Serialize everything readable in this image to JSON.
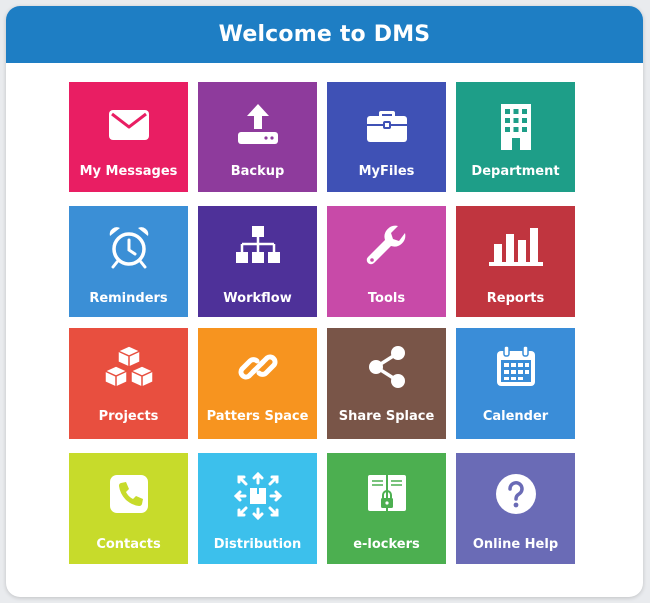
{
  "header": {
    "title": "Welcome to DMS"
  },
  "tiles": [
    {
      "label": "My Messages",
      "color": "#e91e63",
      "icon": "envelope-icon"
    },
    {
      "label": "Backup",
      "color": "#8e3b9c",
      "icon": "upload-icon"
    },
    {
      "label": "MyFiles",
      "color": "#3f51b5",
      "icon": "briefcase-icon"
    },
    {
      "label": "Department",
      "color": "#1e9e88",
      "icon": "building-icon"
    },
    {
      "label": "Reminders",
      "color": "#3b8fd6",
      "icon": "alarm-clock-icon"
    },
    {
      "label": "Workflow",
      "color": "#4e3199",
      "icon": "sitemap-icon"
    },
    {
      "label": "Tools",
      "color": "#c84aa8",
      "icon": "wrench-icon"
    },
    {
      "label": "Reports",
      "color": "#c0353f",
      "icon": "bar-chart-icon"
    },
    {
      "label": "Projects",
      "color": "#e84f3f",
      "icon": "cubes-icon"
    },
    {
      "label": "Patters Space",
      "color": "#f7941f",
      "icon": "link-icon"
    },
    {
      "label": "Share Splace",
      "color": "#795548",
      "icon": "share-icon"
    },
    {
      "label": "Calender",
      "color": "#3a8dd8",
      "icon": "calendar-icon"
    },
    {
      "label": "Contacts",
      "color": "#c7db2b",
      "icon": "phone-icon"
    },
    {
      "label": "Distribution",
      "color": "#3cc0ec",
      "icon": "distribution-icon"
    },
    {
      "label": "e-lockers",
      "color": "#4caf50",
      "icon": "locker-icon"
    },
    {
      "label": "Online Help",
      "color": "#6a6bb6",
      "icon": "question-icon"
    }
  ]
}
